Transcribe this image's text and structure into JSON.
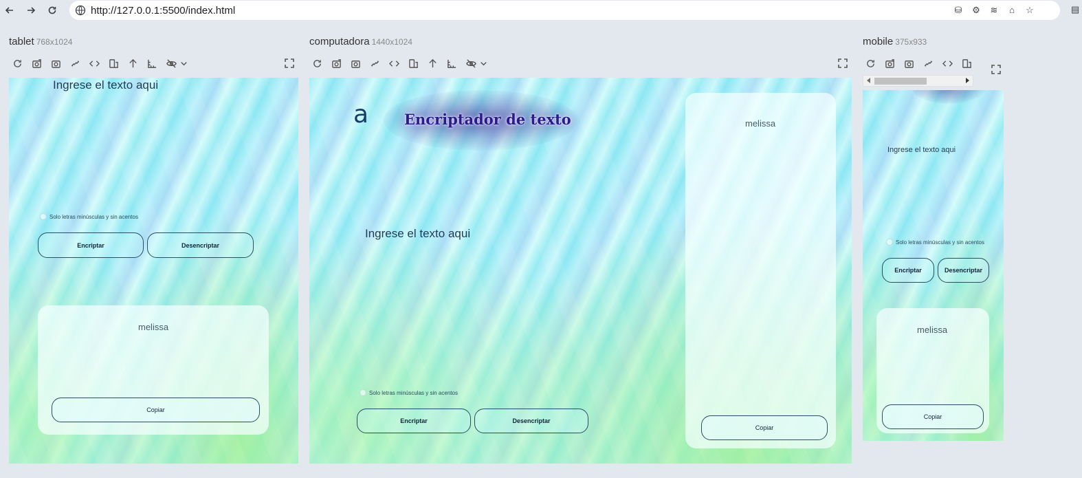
{
  "browser": {
    "url": "http://127.0.0.1:5500/index.html"
  },
  "devices": {
    "tablet": {
      "name": "tablet",
      "dims": "768x1024"
    },
    "computer": {
      "name": "computadora",
      "dims": "1440x1024"
    },
    "mobile": {
      "name": "mobile",
      "dims": "375x933"
    }
  },
  "app": {
    "logo": "a",
    "title": "Encriptador de texto",
    "input_placeholder": "Ingrese el texto aqui",
    "note": "Solo letras minúsculas y sin acentos",
    "encrypt_label": "Encriptar",
    "decrypt_label": "Desencriptar",
    "output_text": "melissa",
    "copy_label": "Copiar"
  },
  "colors": {
    "page_background": "#e3e8ef",
    "button_border": "#2a4d63",
    "title_color": "#2a1c8a"
  }
}
